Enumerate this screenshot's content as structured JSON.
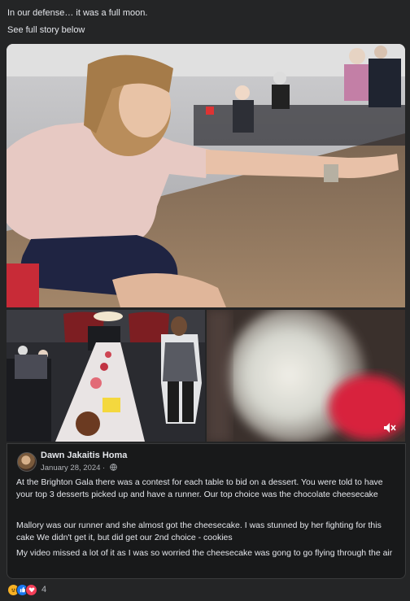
{
  "post": {
    "text_line_1": "In our defense… it was a full moon.",
    "text_line_2": "See full story below"
  },
  "media": {
    "main_photo_alt": "",
    "mute_icon": "speaker-muted-icon"
  },
  "shared": {
    "author": "Dawn Jakaitis Homa",
    "date": "January 28, 2024 · ",
    "paragraphs": [
      "At the Brighton Gala there was a contest for each table to bid on a dessert.  You were told to have your top 3 desserts picked up and have a runner.  Our top choice was the chocolate cheesecake",
      "Mallory was our runner and she almost got the cheesecake.  I was stunned by her fighting for this cake  We didn't get it, but did get our 2nd choice - cookies",
      "My video missed a lot of it as I was so worried the cheesecake was gong to go flying through the air"
    ]
  },
  "reactions": {
    "count": "4",
    "colors": {
      "haha": "#f7b125",
      "like": "#1877f2",
      "love": "#f33e58"
    }
  }
}
